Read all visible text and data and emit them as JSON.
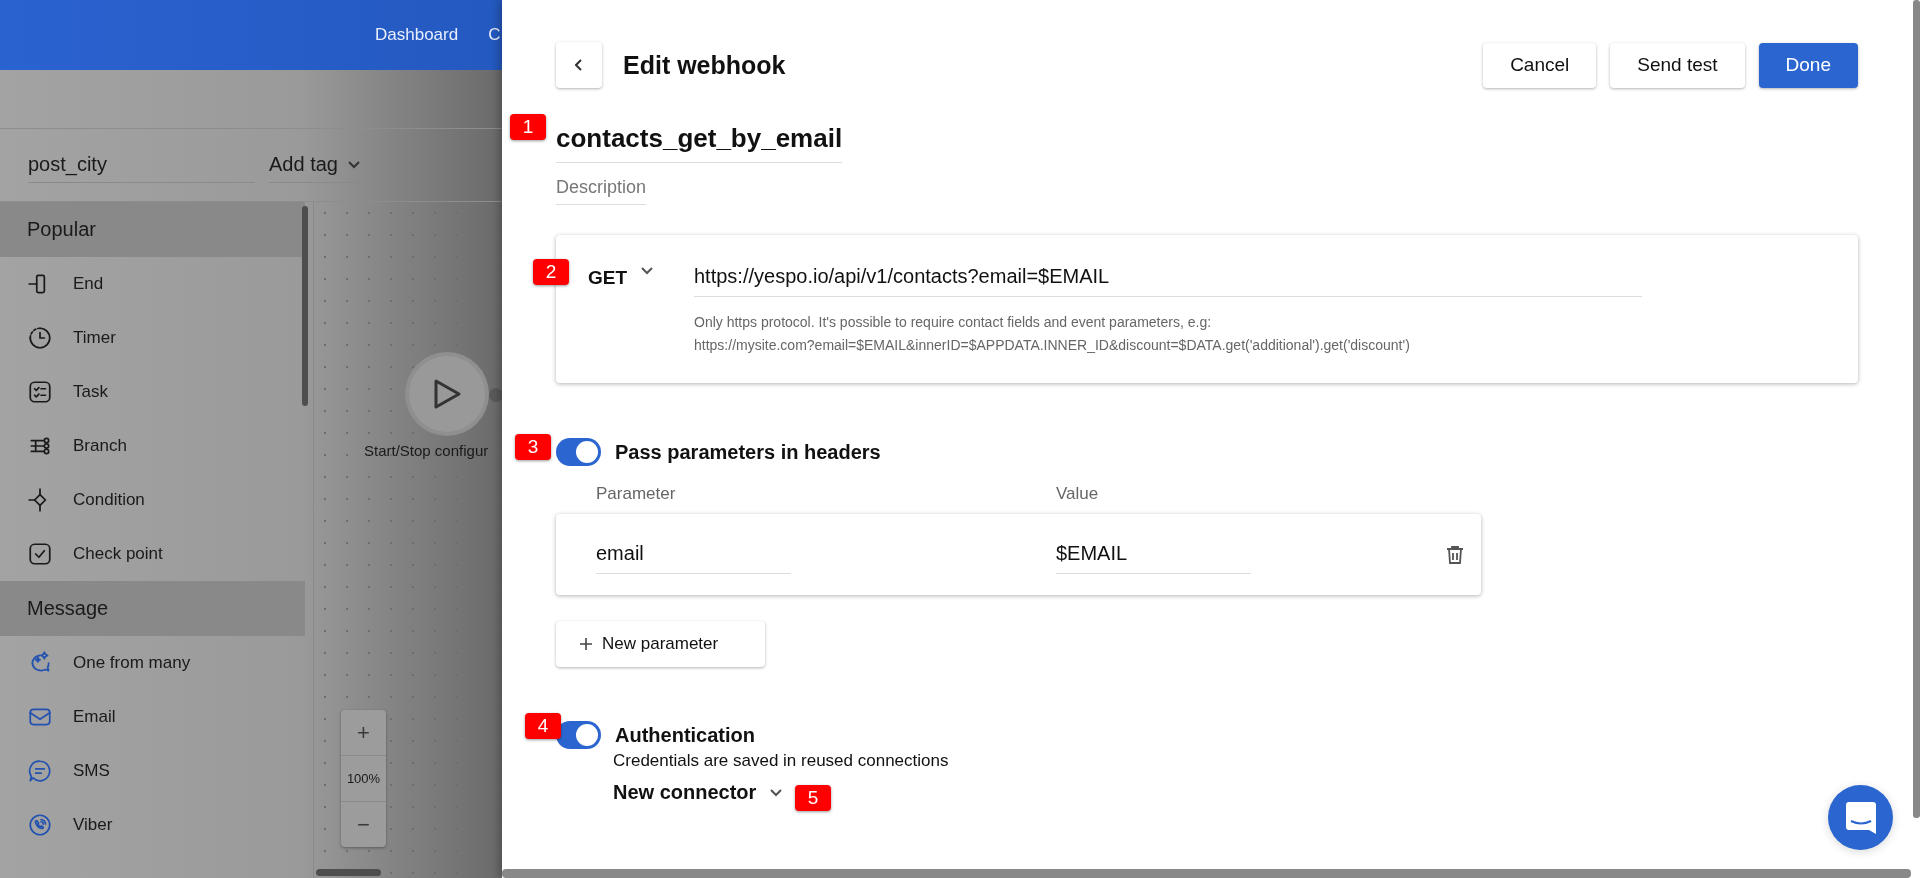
{
  "app_header": {
    "nav": [
      "Dashboard",
      "C"
    ]
  },
  "toolbar": {
    "name_value": "post_city",
    "tag_placeholder": "Add tag"
  },
  "palette": [
    {
      "title": "Popular",
      "items": [
        "End",
        "Timer",
        "Task",
        "Branch",
        "Condition",
        "Check point"
      ]
    },
    {
      "title": "Message",
      "items": [
        "One from many",
        "Email",
        "SMS",
        "Viber"
      ]
    }
  ],
  "canvas": {
    "node_label": "Start/Stop configur",
    "zoom_in": "+",
    "zoom_level": "100%",
    "zoom_out": "−"
  },
  "drawer": {
    "title": "Edit webhook",
    "buttons": [
      {
        "label": "Cancel",
        "kind": "secondary"
      },
      {
        "label": "Send test",
        "kind": "secondary"
      },
      {
        "label": "Done",
        "kind": "primary"
      }
    ],
    "name": "contacts_get_by_email",
    "description_placeholder": "Description",
    "request": {
      "method": "GET",
      "url": "https://yespo.io/api/v1/contacts?email=$EMAIL",
      "hint_lines": [
        "Only https protocol. It's possible to require contact fields and event parameters, e.g:",
        "https://mysite.com?email=$EMAIL&innerID=$APPDATA.INNER_ID&discount=$DATA.get('additional').get('discount')"
      ]
    },
    "headers": {
      "label": "Pass parameters in headers",
      "on": true,
      "columns": [
        "Parameter",
        "Value"
      ],
      "rows": [
        {
          "parameter": "email",
          "value": "$EMAIL"
        }
      ],
      "add_label": "New parameter"
    },
    "auth": {
      "label": "Authentication",
      "on": true,
      "note": "Credentials are saved in reused connections",
      "connector": "New connector"
    }
  },
  "annotations": [
    "1",
    "2",
    "3",
    "4",
    "5"
  ]
}
